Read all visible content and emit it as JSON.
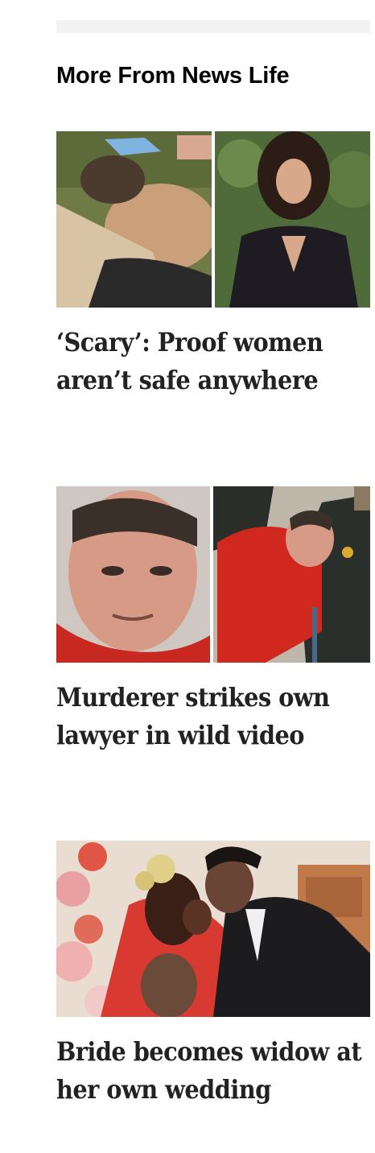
{
  "section": {
    "title": "More From News Life"
  },
  "articles": [
    {
      "headline": "‘Scary’: Proof women aren’t safe anywhere",
      "image_alt": "composite photo: people helping a woman on the grass and a smiling woman with curly hair"
    },
    {
      "headline": "Murderer strikes own lawyer in wild video",
      "image_alt": "composite photo: a man in a red jumpsuit in court and deputies restraining him"
    },
    {
      "headline": "Bride becomes widow at her own wedding",
      "image_alt": "photo: bride and groom kissing at wedding"
    }
  ],
  "colors": {
    "headline": "#222222",
    "title": "#000000",
    "top_bar": "#f2f2f2"
  }
}
